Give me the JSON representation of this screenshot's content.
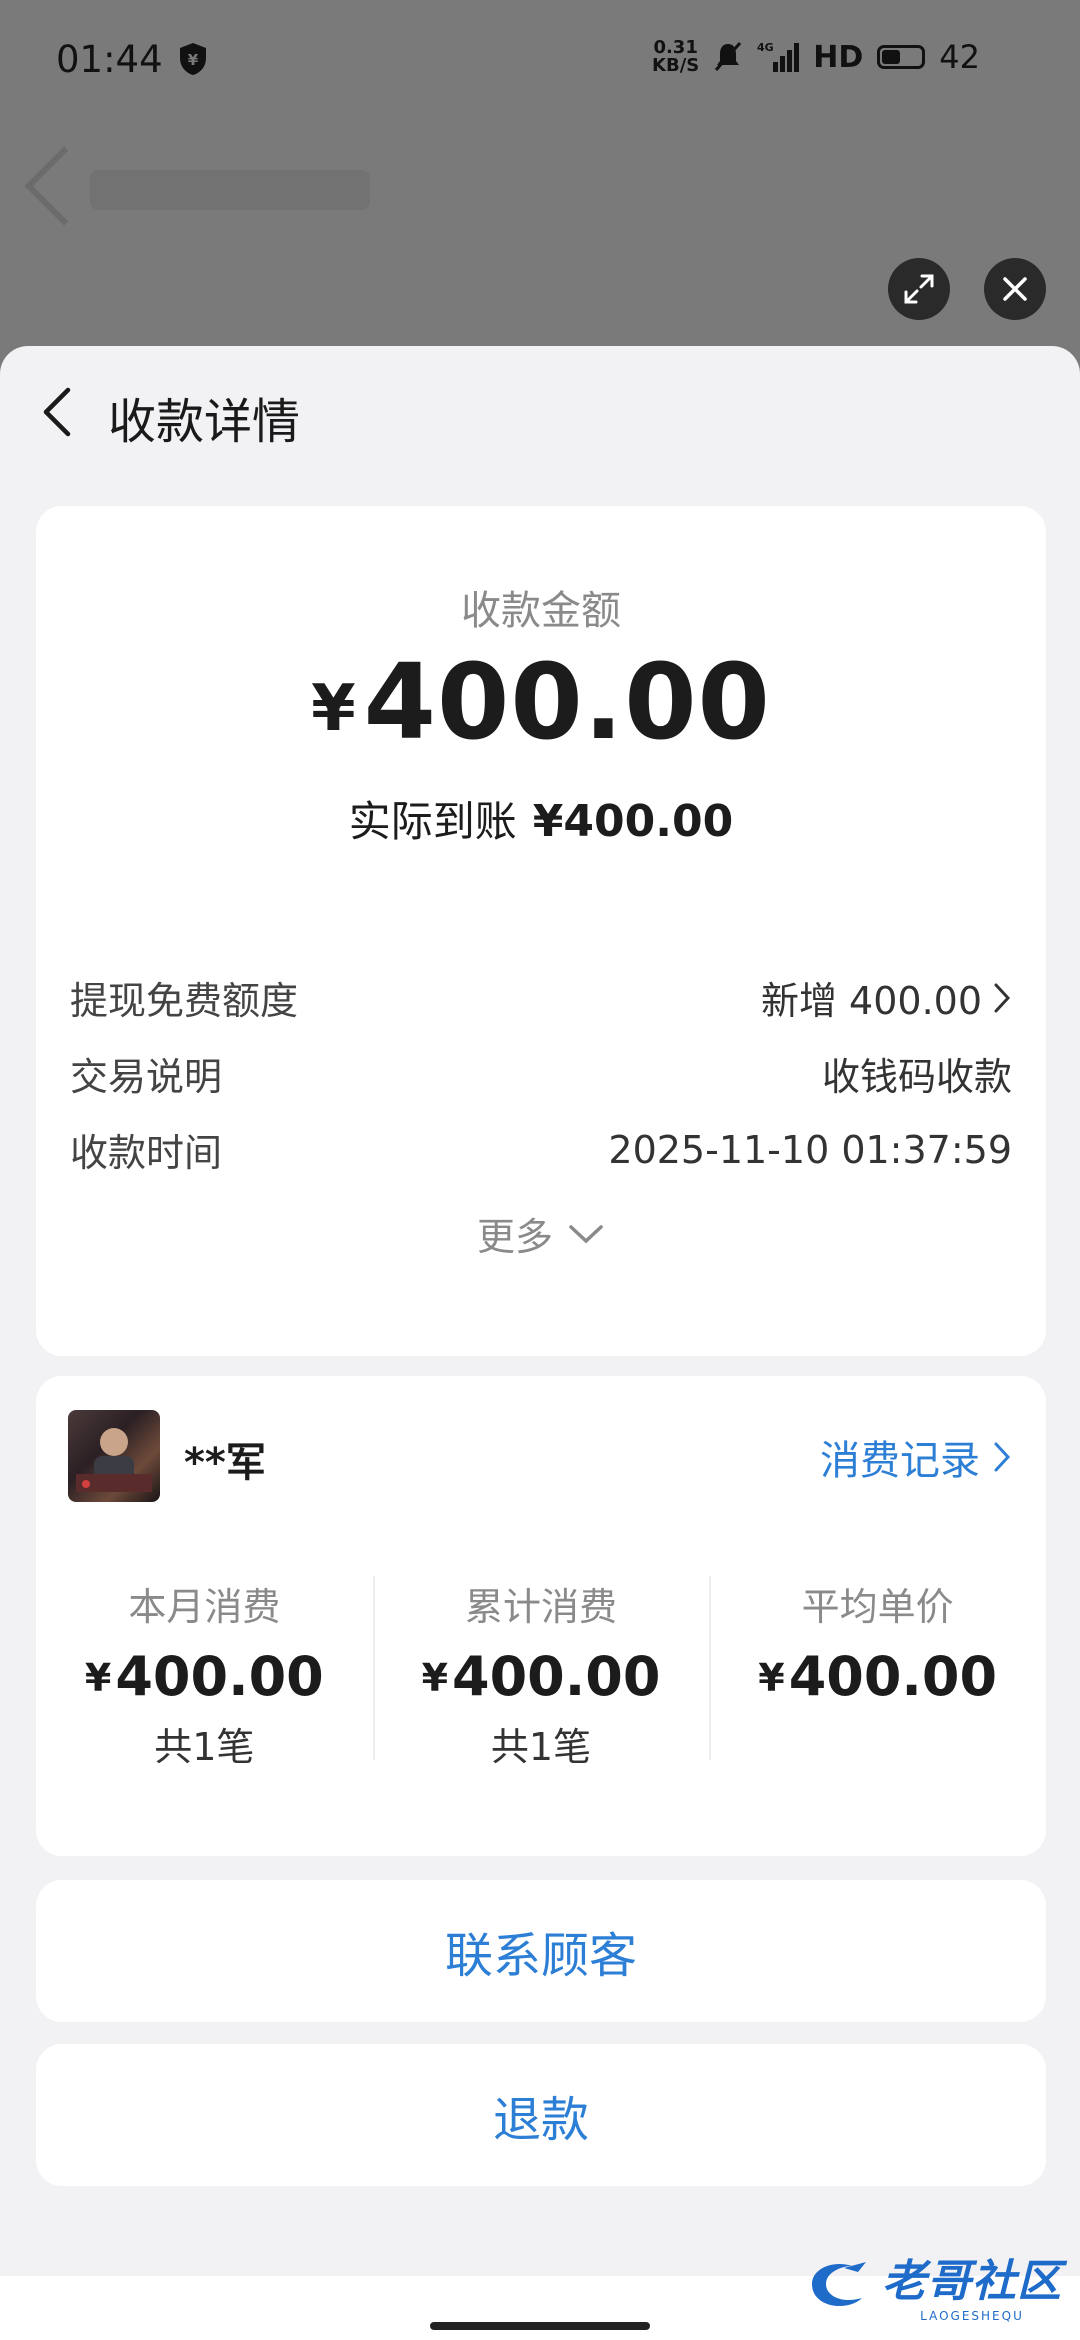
{
  "status_bar": {
    "time": "01:44",
    "speed_top": "0.31",
    "speed_bottom": "KB/S",
    "network": "4G",
    "hd": "HD",
    "battery": "42"
  },
  "header": {
    "title": "收款详情"
  },
  "amount_card": {
    "label": "收款金额",
    "currency": "¥",
    "amount": "400.00",
    "actual_label": "实际到账",
    "actual_amount": "¥400.00",
    "rows": [
      {
        "label": "提现免费额度",
        "value": "新增 400.00"
      },
      {
        "label": "交易说明",
        "value": "收钱码收款"
      },
      {
        "label": "收款时间",
        "value": "2025-11-10 01:37:59"
      }
    ],
    "more": "更多"
  },
  "customer": {
    "name": "**军",
    "records_link": "消费记录",
    "stats": [
      {
        "label": "本月消费",
        "currency": "¥",
        "amount": "400.00",
        "count": "共1笔"
      },
      {
        "label": "累计消费",
        "currency": "¥",
        "amount": "400.00",
        "count": "共1笔"
      },
      {
        "label": "平均单价",
        "currency": "¥",
        "amount": "400.00",
        "count": ""
      }
    ]
  },
  "actions": {
    "contact": "联系顾客",
    "refund": "退款"
  },
  "watermark": {
    "text": "老哥社区",
    "sub": "LAOGESHEQU"
  },
  "colors": {
    "accent": "#2d7fd6",
    "sheet_bg": "#f2f2f5",
    "overlay": "#7a7a7a"
  }
}
